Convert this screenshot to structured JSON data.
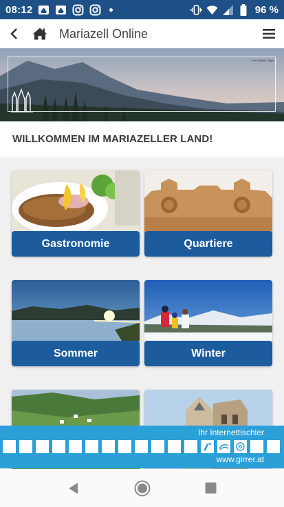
{
  "status_bar": {
    "time": "08:12",
    "battery_percent": "96 %",
    "icons": [
      "notification-icon",
      "notification-icon",
      "instagram-icon",
      "instagram-icon",
      "dot-icon",
      "vibrate-icon",
      "wifi-icon",
      "signal-icon",
      "battery-icon"
    ]
  },
  "app_bar": {
    "title": "Mariazell Online",
    "icons": [
      "back-icon",
      "home-icon",
      "menu-icon"
    ]
  },
  "hero": {
    "credit": "Foto: Walter Gigler"
  },
  "welcome": {
    "heading": "WILLKOMMEN IM MARIAZELLER LAND!"
  },
  "tiles": [
    {
      "label": "Gastronomie"
    },
    {
      "label": "Quartiere"
    },
    {
      "label": "Sommer"
    },
    {
      "label": "Winter"
    }
  ],
  "footer_banner": {
    "tagline": "Ihr Internettischler",
    "url": "www.girrer.at"
  },
  "colors": {
    "status_bar": "#1e4f86",
    "tile_label": "#1c5c9c",
    "banner": "#2b9fd8",
    "content_bg": "#f0f0f0"
  }
}
